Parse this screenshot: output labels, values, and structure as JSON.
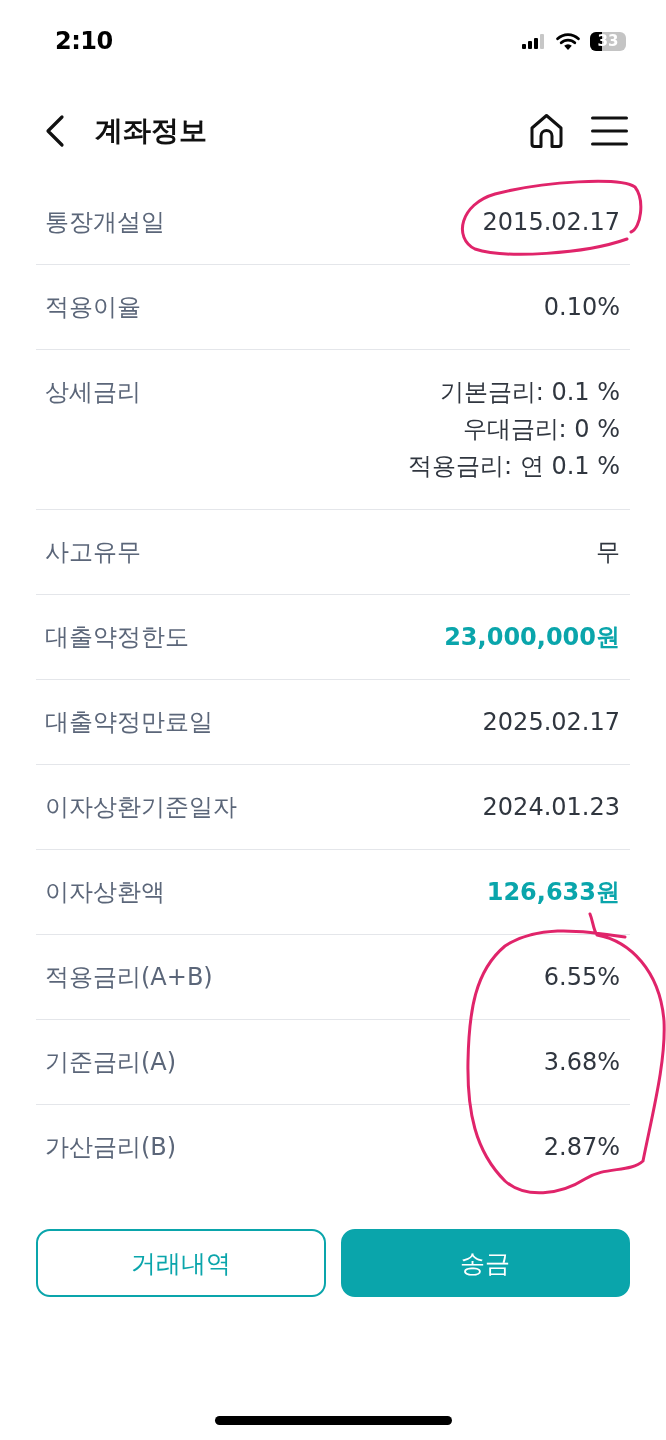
{
  "status_bar": {
    "time": "2:10",
    "battery": "33"
  },
  "header": {
    "title": "계좌정보"
  },
  "rows": [
    {
      "kind": "single",
      "label": "통장개설일",
      "value": "2015.02.17",
      "accent": false
    },
    {
      "kind": "single",
      "label": "적용이율",
      "value": "0.10%",
      "accent": false
    },
    {
      "kind": "multi",
      "label": "상세금리",
      "lines": [
        "기본금리: 0.1 %",
        "우대금리: 0 %",
        "적용금리: 연 0.1 %"
      ],
      "accent": false
    },
    {
      "kind": "single",
      "label": "사고유무",
      "value": "무",
      "accent": false
    },
    {
      "kind": "single",
      "label": "대출약정한도",
      "value": "23,000,000원",
      "accent": true
    },
    {
      "kind": "single",
      "label": "대출약정만료일",
      "value": "2025.02.17",
      "accent": false
    },
    {
      "kind": "single",
      "label": "이자상환기준일자",
      "value": "2024.01.23",
      "accent": false
    },
    {
      "kind": "single",
      "label": "이자상환액",
      "value": "126,633원",
      "accent": true
    },
    {
      "kind": "single",
      "label": "적용금리(A+B)",
      "value": "6.55%",
      "accent": false
    },
    {
      "kind": "single",
      "label": "기준금리(A)",
      "value": "3.68%",
      "accent": false
    },
    {
      "kind": "single",
      "label": "가산금리(B)",
      "value": "2.87%",
      "accent": false
    }
  ],
  "buttons": [
    {
      "kind": "outline",
      "label": "거래내역"
    },
    {
      "kind": "filled",
      "label": "송금"
    }
  ]
}
